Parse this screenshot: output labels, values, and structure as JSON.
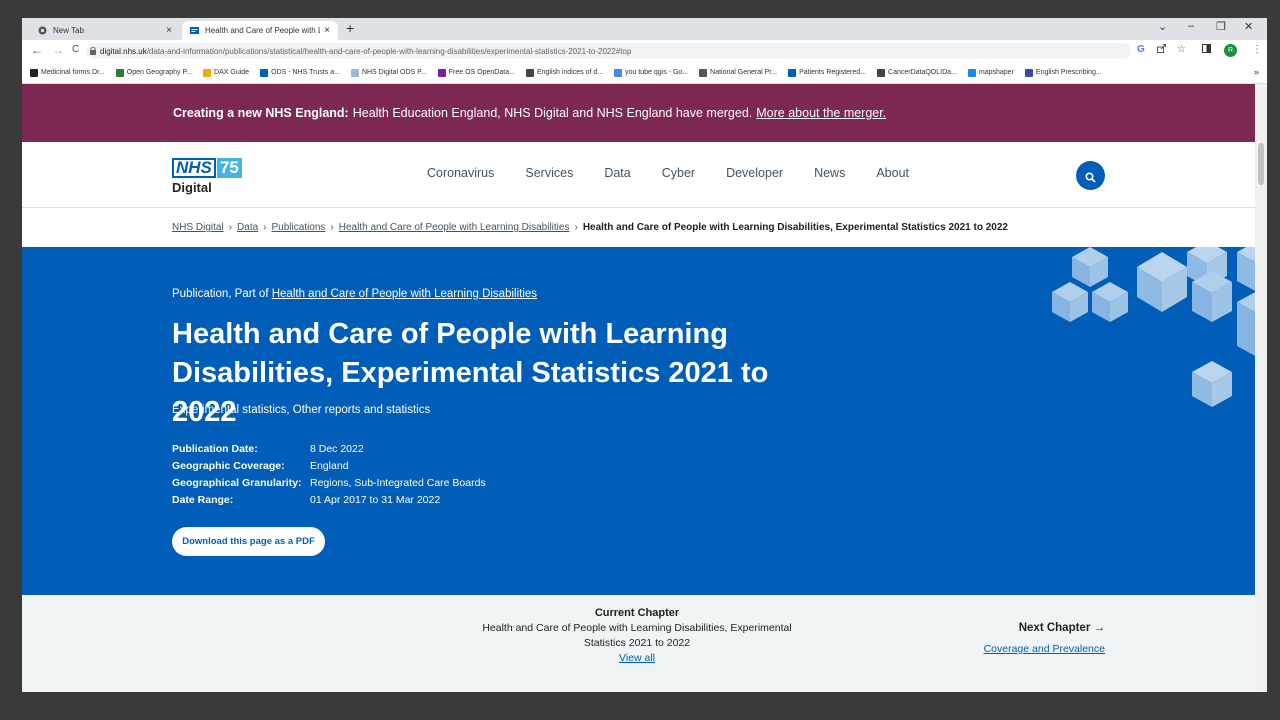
{
  "browser": {
    "tabs": [
      {
        "title": "New Tab",
        "close": "×"
      },
      {
        "title": "Health and Care of People with L",
        "close": "×"
      }
    ],
    "new_tab": "+",
    "window_controls": {
      "dropdown": "⌄",
      "minimize": "–",
      "restore": "❐",
      "close": "✕"
    },
    "nav": {
      "back": "←",
      "forward": "→",
      "reload": "C"
    },
    "url_domain": "digital.nhs.uk",
    "url_path": "/data-and-information/publications/statistical/health-and-care-of-people-with-learning-disabilities/experimental-statistics-2021-to-2022#top",
    "avatar": "R",
    "bookmarks": [
      {
        "label": "Medicinal forms Dr...",
        "color": "#222222"
      },
      {
        "label": "Open Geography P...",
        "color": "#2e7d32"
      },
      {
        "label": "DAX Guide",
        "color": "#f2a900"
      },
      {
        "label": "ODS - NHS Trusts a...",
        "color": "#005eb8"
      },
      {
        "label": "NHS Digital ODS P...",
        "color": "#9fb8d8"
      },
      {
        "label": "Free OS OpenData...",
        "color": "#7b1fa2"
      },
      {
        "label": "English indices of d...",
        "color": "#444444"
      },
      {
        "label": "you tube qgis - Go...",
        "color": "#4285f4"
      },
      {
        "label": "National General Pr...",
        "color": "#555555"
      },
      {
        "label": "Patients Registered...",
        "color": "#005eb8"
      },
      {
        "label": "CancerDataQOLIDa...",
        "color": "#444444"
      },
      {
        "label": "mapshaper",
        "color": "#1e88e5"
      },
      {
        "label": "English Prescribing...",
        "color": "#3949ab"
      }
    ],
    "bookmarks_more": "»"
  },
  "banner": {
    "bold": "Creating a new NHS England:",
    "text": "Health Education England, NHS Digital and NHS England have merged.",
    "link": "More about the merger."
  },
  "header": {
    "logo_nhs": "NHS",
    "logo_75": "75",
    "logo_digital": "Digital",
    "menu": [
      "Coronavirus",
      "Services",
      "Data",
      "Cyber",
      "Developer",
      "News",
      "About"
    ]
  },
  "breadcrumb": {
    "items": [
      "NHS Digital",
      "Data",
      "Publications",
      "Health and Care of People with Learning Disabilities"
    ],
    "current": "Health and Care of People with Learning Disabilities, Experimental Statistics 2021 to 2022",
    "separator": "›"
  },
  "hero": {
    "part_prefix": "Publication, Part of",
    "part_link": "Health and Care of People with Learning Disabilities",
    "title": "Health and Care of People with Learning Disabilities, Experimental Statistics 2021 to 2022",
    "categories": "Experimental statistics, Other reports and statistics",
    "meta": [
      {
        "key": "Publication Date:",
        "value": "8 Dec 2022"
      },
      {
        "key": "Geographic Coverage:",
        "value": "England"
      },
      {
        "key": "Geographical Granularity:",
        "value": "Regions, Sub-Integrated Care Boards"
      },
      {
        "key": "Date Range:",
        "value": "01 Apr 2017 to 31 Mar 2022"
      }
    ],
    "pdf_button": "Download this page as a PDF"
  },
  "chapters": {
    "current_heading": "Current Chapter",
    "current_title": "Health and Care of People with Learning Disabilities, Experimental Statistics 2021 to 2022",
    "view_all": "View all",
    "next_heading": "Next Chapter →",
    "next_link": "Coverage and Prevalence"
  }
}
